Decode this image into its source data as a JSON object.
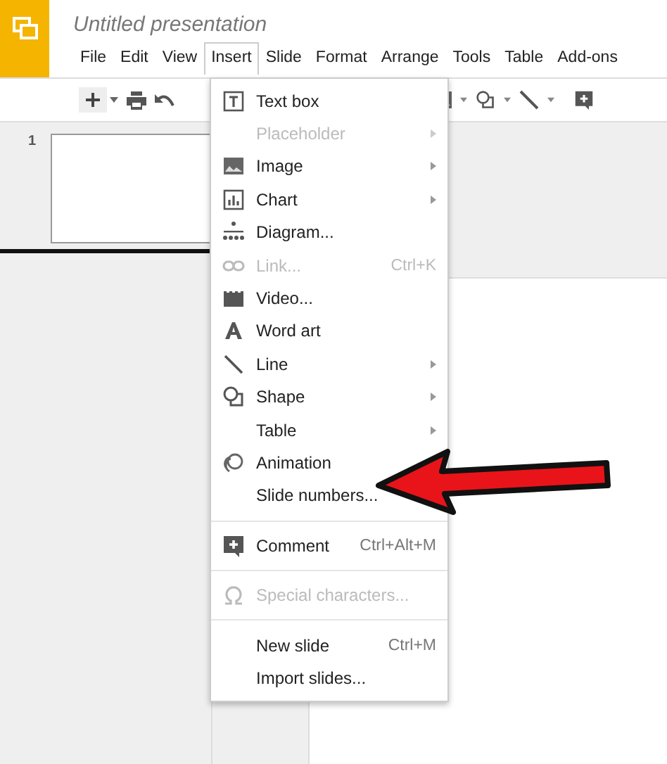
{
  "title": "Untitled presentation",
  "menubar": [
    {
      "label": "File",
      "selected": false
    },
    {
      "label": "Edit",
      "selected": false
    },
    {
      "label": "View",
      "selected": false
    },
    {
      "label": "Insert",
      "selected": true
    },
    {
      "label": "Slide",
      "selected": false
    },
    {
      "label": "Format",
      "selected": false
    },
    {
      "label": "Arrange",
      "selected": false
    },
    {
      "label": "Tools",
      "selected": false
    },
    {
      "label": "Table",
      "selected": false
    },
    {
      "label": "Add-ons",
      "selected": false
    }
  ],
  "filmstrip": [
    {
      "number": "1",
      "selected": true
    }
  ],
  "insert_menu": [
    {
      "kind": "item",
      "label": "Text box",
      "disabled": false,
      "submenu": false
    },
    {
      "kind": "item",
      "label": "Placeholder",
      "disabled": true,
      "submenu": true
    },
    {
      "kind": "item",
      "label": "Image",
      "disabled": false,
      "submenu": true
    },
    {
      "kind": "item",
      "label": "Chart",
      "disabled": false,
      "submenu": true
    },
    {
      "kind": "item",
      "label": "Diagram...",
      "disabled": false,
      "submenu": false
    },
    {
      "kind": "item",
      "label": "Link...",
      "shortcut": "Ctrl+K",
      "disabled": true,
      "submenu": false
    },
    {
      "kind": "item",
      "label": "Video...",
      "disabled": false,
      "submenu": false
    },
    {
      "kind": "item",
      "label": "Word art",
      "disabled": false,
      "submenu": false
    },
    {
      "kind": "item",
      "label": "Line",
      "disabled": false,
      "submenu": true
    },
    {
      "kind": "item",
      "label": "Shape",
      "disabled": false,
      "submenu": true
    },
    {
      "kind": "item",
      "label": "Table",
      "disabled": false,
      "submenu": true
    },
    {
      "kind": "item",
      "label": "Animation",
      "disabled": false
    },
    {
      "kind": "item",
      "label": "Slide numbers...",
      "disabled": false
    },
    {
      "kind": "separator"
    },
    {
      "kind": "item",
      "label": "Comment",
      "shortcut": "Ctrl+Alt+M",
      "disabled": false,
      "submenu": false
    },
    {
      "kind": "separator"
    },
    {
      "kind": "item",
      "label": "Special characters...",
      "disabled": true,
      "submenu": false
    },
    {
      "kind": "separator"
    },
    {
      "kind": "item",
      "label": "New slide",
      "shortcut": "Ctrl+M",
      "disabled": false,
      "submenu": false
    },
    {
      "kind": "item",
      "label": "Import slides...",
      "disabled": false,
      "submenu": false
    }
  ]
}
